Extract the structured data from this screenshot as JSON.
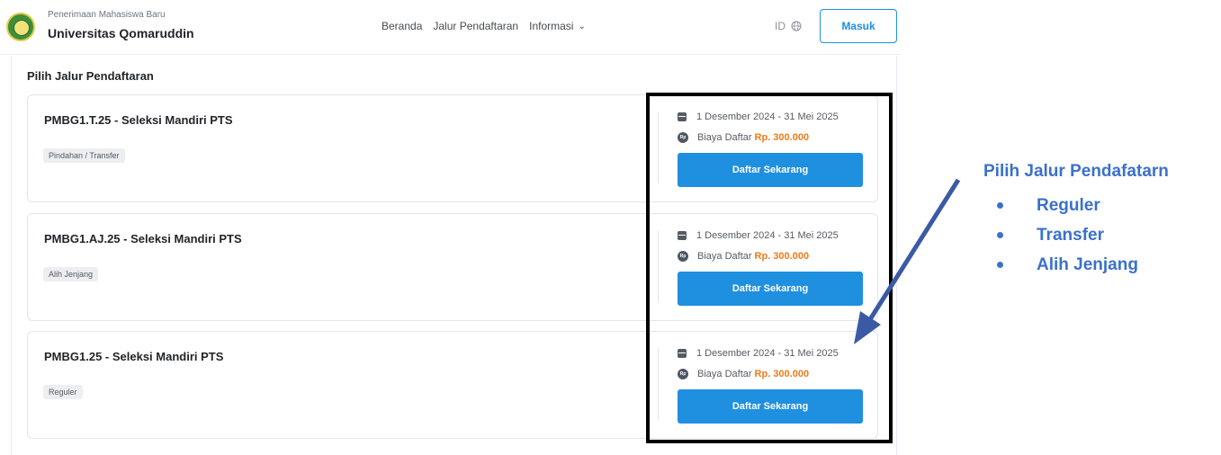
{
  "header": {
    "brand_sub": "Penerimaan Mahasiswa Baru",
    "brand_title": "Universitas Qomaruddin",
    "nav": [
      "Beranda",
      "Jalur Pendaftaran",
      "Informasi"
    ],
    "lang": "ID",
    "login_label": "Masuk",
    "logo_icon": "university-seal-icon",
    "globe_icon": "globe-icon"
  },
  "main": {
    "title": "Pilih Jalur Pendaftaran",
    "cards": [
      {
        "name": "PMBG1.T.25 - Seleksi Mandiri PTS",
        "badge": "Pindahan / Transfer",
        "date": "1 Desember 2024 - 31 Mei 2025",
        "fee_label": "Biaya Daftar",
        "fee_amount": "Rp. 300.000",
        "button": "Daftar Sekarang"
      },
      {
        "name": "PMBG1.AJ.25 - Seleksi Mandiri PTS",
        "badge": "Alih Jenjang",
        "date": "1 Desember 2024 - 31 Mei 2025",
        "fee_label": "Biaya Daftar",
        "fee_amount": "Rp. 300.000",
        "button": "Daftar Sekarang"
      },
      {
        "name": "PMBG1.25 - Seleksi Mandiri PTS",
        "badge": "Reguler",
        "date": "1 Desember 2024 - 31 Mei 2025",
        "fee_label": "Biaya Daftar",
        "fee_amount": "Rp. 300.000",
        "button": "Daftar Sekarang"
      }
    ],
    "rp_icon_text": "Rp"
  },
  "annotation": {
    "title": "Pilih Jalur Pendafatarn",
    "items": [
      "Reguler",
      "Transfer",
      "Alih Jenjang"
    ],
    "color": "#3b71c9"
  },
  "colors": {
    "primary": "#1f8fe0",
    "fee": "#ee7b1c"
  }
}
